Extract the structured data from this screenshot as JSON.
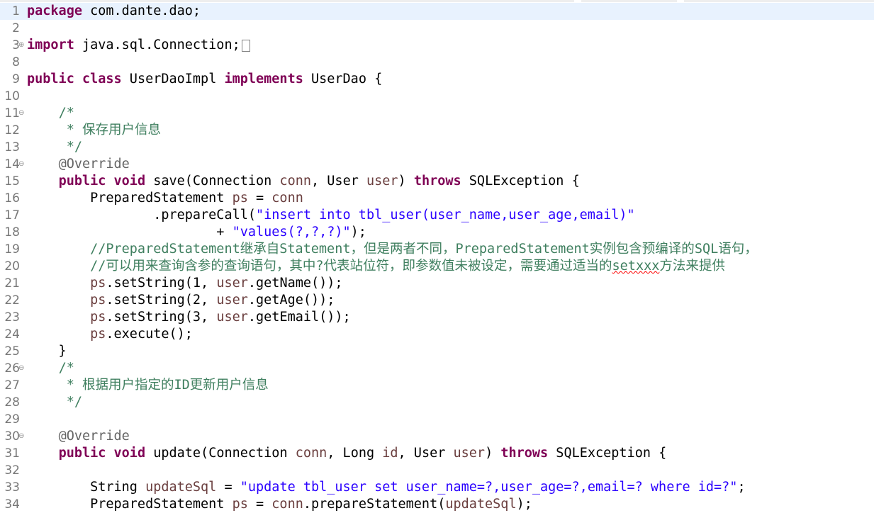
{
  "editor": {
    "lines": [
      {
        "n": "1",
        "current": true,
        "tokens": [
          {
            "t": "kw",
            "v": "package"
          },
          {
            "t": "plain",
            "v": " com.dante.dao;"
          }
        ]
      },
      {
        "n": "2",
        "tokens": []
      },
      {
        "n": "3",
        "fold": "expand",
        "tokens": [
          {
            "t": "kw",
            "v": "import"
          },
          {
            "t": "plain",
            "v": " java.sql.Connection;"
          },
          {
            "t": "box",
            "v": ""
          }
        ]
      },
      {
        "n": "8",
        "tokens": []
      },
      {
        "n": "9",
        "tokens": [
          {
            "t": "kw",
            "v": "public"
          },
          {
            "t": "plain",
            "v": " "
          },
          {
            "t": "kw",
            "v": "class"
          },
          {
            "t": "plain",
            "v": " UserDaoImpl "
          },
          {
            "t": "kw",
            "v": "implements"
          },
          {
            "t": "plain",
            "v": " UserDao {"
          }
        ]
      },
      {
        "n": "10",
        "tokens": []
      },
      {
        "n": "11",
        "fold": "collapse",
        "tokens": [
          {
            "t": "plain",
            "v": "    "
          },
          {
            "t": "cm",
            "v": "/*"
          }
        ]
      },
      {
        "n": "12",
        "tokens": [
          {
            "t": "cm",
            "v": "     * 保存用户信息"
          }
        ]
      },
      {
        "n": "13",
        "tokens": [
          {
            "t": "cm",
            "v": "     */"
          }
        ]
      },
      {
        "n": "14",
        "fold": "collapse",
        "tokens": [
          {
            "t": "plain",
            "v": "    "
          },
          {
            "t": "ann",
            "v": "@Override"
          }
        ]
      },
      {
        "n": "15",
        "tokens": [
          {
            "t": "plain",
            "v": "    "
          },
          {
            "t": "kw",
            "v": "public"
          },
          {
            "t": "plain",
            "v": " "
          },
          {
            "t": "kw",
            "v": "void"
          },
          {
            "t": "plain",
            "v": " save(Connection "
          },
          {
            "t": "var",
            "v": "conn"
          },
          {
            "t": "plain",
            "v": ", User "
          },
          {
            "t": "var",
            "v": "user"
          },
          {
            "t": "plain",
            "v": ") "
          },
          {
            "t": "kw",
            "v": "throws"
          },
          {
            "t": "plain",
            "v": " SQLException {"
          }
        ]
      },
      {
        "n": "16",
        "tokens": [
          {
            "t": "plain",
            "v": "        PreparedStatement "
          },
          {
            "t": "var",
            "v": "ps"
          },
          {
            "t": "plain",
            "v": " = "
          },
          {
            "t": "var",
            "v": "conn"
          }
        ]
      },
      {
        "n": "17",
        "tokens": [
          {
            "t": "plain",
            "v": "                .prepareCall("
          },
          {
            "t": "str",
            "v": "\"insert into tbl_user(user_name,user_age,email)\""
          }
        ]
      },
      {
        "n": "18",
        "tokens": [
          {
            "t": "plain",
            "v": "                        + "
          },
          {
            "t": "str",
            "v": "\"values(?,?,?)\""
          },
          {
            "t": "plain",
            "v": ");"
          }
        ]
      },
      {
        "n": "19",
        "tokens": [
          {
            "t": "cm",
            "v": "        //PreparedStatement继承自Statement，但是两者不同，PreparedStatement实例包含预编译的SQL语句，"
          }
        ]
      },
      {
        "n": "20",
        "tokens": [
          {
            "t": "cm",
            "v": "        //可以用来查询含参的查询语句，其中?代表站位符，即参数值未被设定，需要通过适当的"
          },
          {
            "t": "cmsq",
            "v": "setxxx"
          },
          {
            "t": "cm",
            "v": "方法来提供"
          }
        ]
      },
      {
        "n": "21",
        "tokens": [
          {
            "t": "plain",
            "v": "        "
          },
          {
            "t": "var",
            "v": "ps"
          },
          {
            "t": "plain",
            "v": ".setString(1, "
          },
          {
            "t": "var",
            "v": "user"
          },
          {
            "t": "plain",
            "v": ".getName());"
          }
        ]
      },
      {
        "n": "22",
        "tokens": [
          {
            "t": "plain",
            "v": "        "
          },
          {
            "t": "var",
            "v": "ps"
          },
          {
            "t": "plain",
            "v": ".setString(2, "
          },
          {
            "t": "var",
            "v": "user"
          },
          {
            "t": "plain",
            "v": ".getAge());"
          }
        ]
      },
      {
        "n": "23",
        "tokens": [
          {
            "t": "plain",
            "v": "        "
          },
          {
            "t": "var",
            "v": "ps"
          },
          {
            "t": "plain",
            "v": ".setString(3, "
          },
          {
            "t": "var",
            "v": "user"
          },
          {
            "t": "plain",
            "v": ".getEmail());"
          }
        ]
      },
      {
        "n": "24",
        "tokens": [
          {
            "t": "plain",
            "v": "        "
          },
          {
            "t": "var",
            "v": "ps"
          },
          {
            "t": "plain",
            "v": ".execute();"
          }
        ]
      },
      {
        "n": "25",
        "tokens": [
          {
            "t": "plain",
            "v": "    }"
          }
        ]
      },
      {
        "n": "26",
        "fold": "collapse",
        "tokens": [
          {
            "t": "plain",
            "v": "    "
          },
          {
            "t": "cm",
            "v": "/*"
          }
        ]
      },
      {
        "n": "27",
        "tokens": [
          {
            "t": "cm",
            "v": "     * 根据用户指定的ID更新用户信息"
          }
        ]
      },
      {
        "n": "28",
        "tokens": [
          {
            "t": "cm",
            "v": "     */"
          }
        ]
      },
      {
        "n": "29",
        "tokens": []
      },
      {
        "n": "30",
        "fold": "collapse",
        "tokens": [
          {
            "t": "plain",
            "v": "    "
          },
          {
            "t": "ann",
            "v": "@Override"
          }
        ]
      },
      {
        "n": "31",
        "tokens": [
          {
            "t": "plain",
            "v": "    "
          },
          {
            "t": "kw",
            "v": "public"
          },
          {
            "t": "plain",
            "v": " "
          },
          {
            "t": "kw",
            "v": "void"
          },
          {
            "t": "plain",
            "v": " update(Connection "
          },
          {
            "t": "var",
            "v": "conn"
          },
          {
            "t": "plain",
            "v": ", Long "
          },
          {
            "t": "var",
            "v": "id"
          },
          {
            "t": "plain",
            "v": ", User "
          },
          {
            "t": "var",
            "v": "user"
          },
          {
            "t": "plain",
            "v": ") "
          },
          {
            "t": "kw",
            "v": "throws"
          },
          {
            "t": "plain",
            "v": " SQLException {"
          }
        ]
      },
      {
        "n": "32",
        "tokens": []
      },
      {
        "n": "33",
        "tokens": [
          {
            "t": "plain",
            "v": "        String "
          },
          {
            "t": "var",
            "v": "updateSql"
          },
          {
            "t": "plain",
            "v": " = "
          },
          {
            "t": "str",
            "v": "\"update tbl_user set user_name=?,user_age=?,email=? where id=?\""
          },
          {
            "t": "plain",
            "v": ";"
          }
        ]
      },
      {
        "n": "34",
        "tokens": [
          {
            "t": "plain",
            "v": "        PreparedStatement "
          },
          {
            "t": "var",
            "v": "ps"
          },
          {
            "t": "plain",
            "v": " = "
          },
          {
            "t": "var",
            "v": "conn"
          },
          {
            "t": "plain",
            "v": ".prepareStatement("
          },
          {
            "t": "var",
            "v": "updateSql"
          },
          {
            "t": "plain",
            "v": ");"
          }
        ]
      }
    ]
  }
}
